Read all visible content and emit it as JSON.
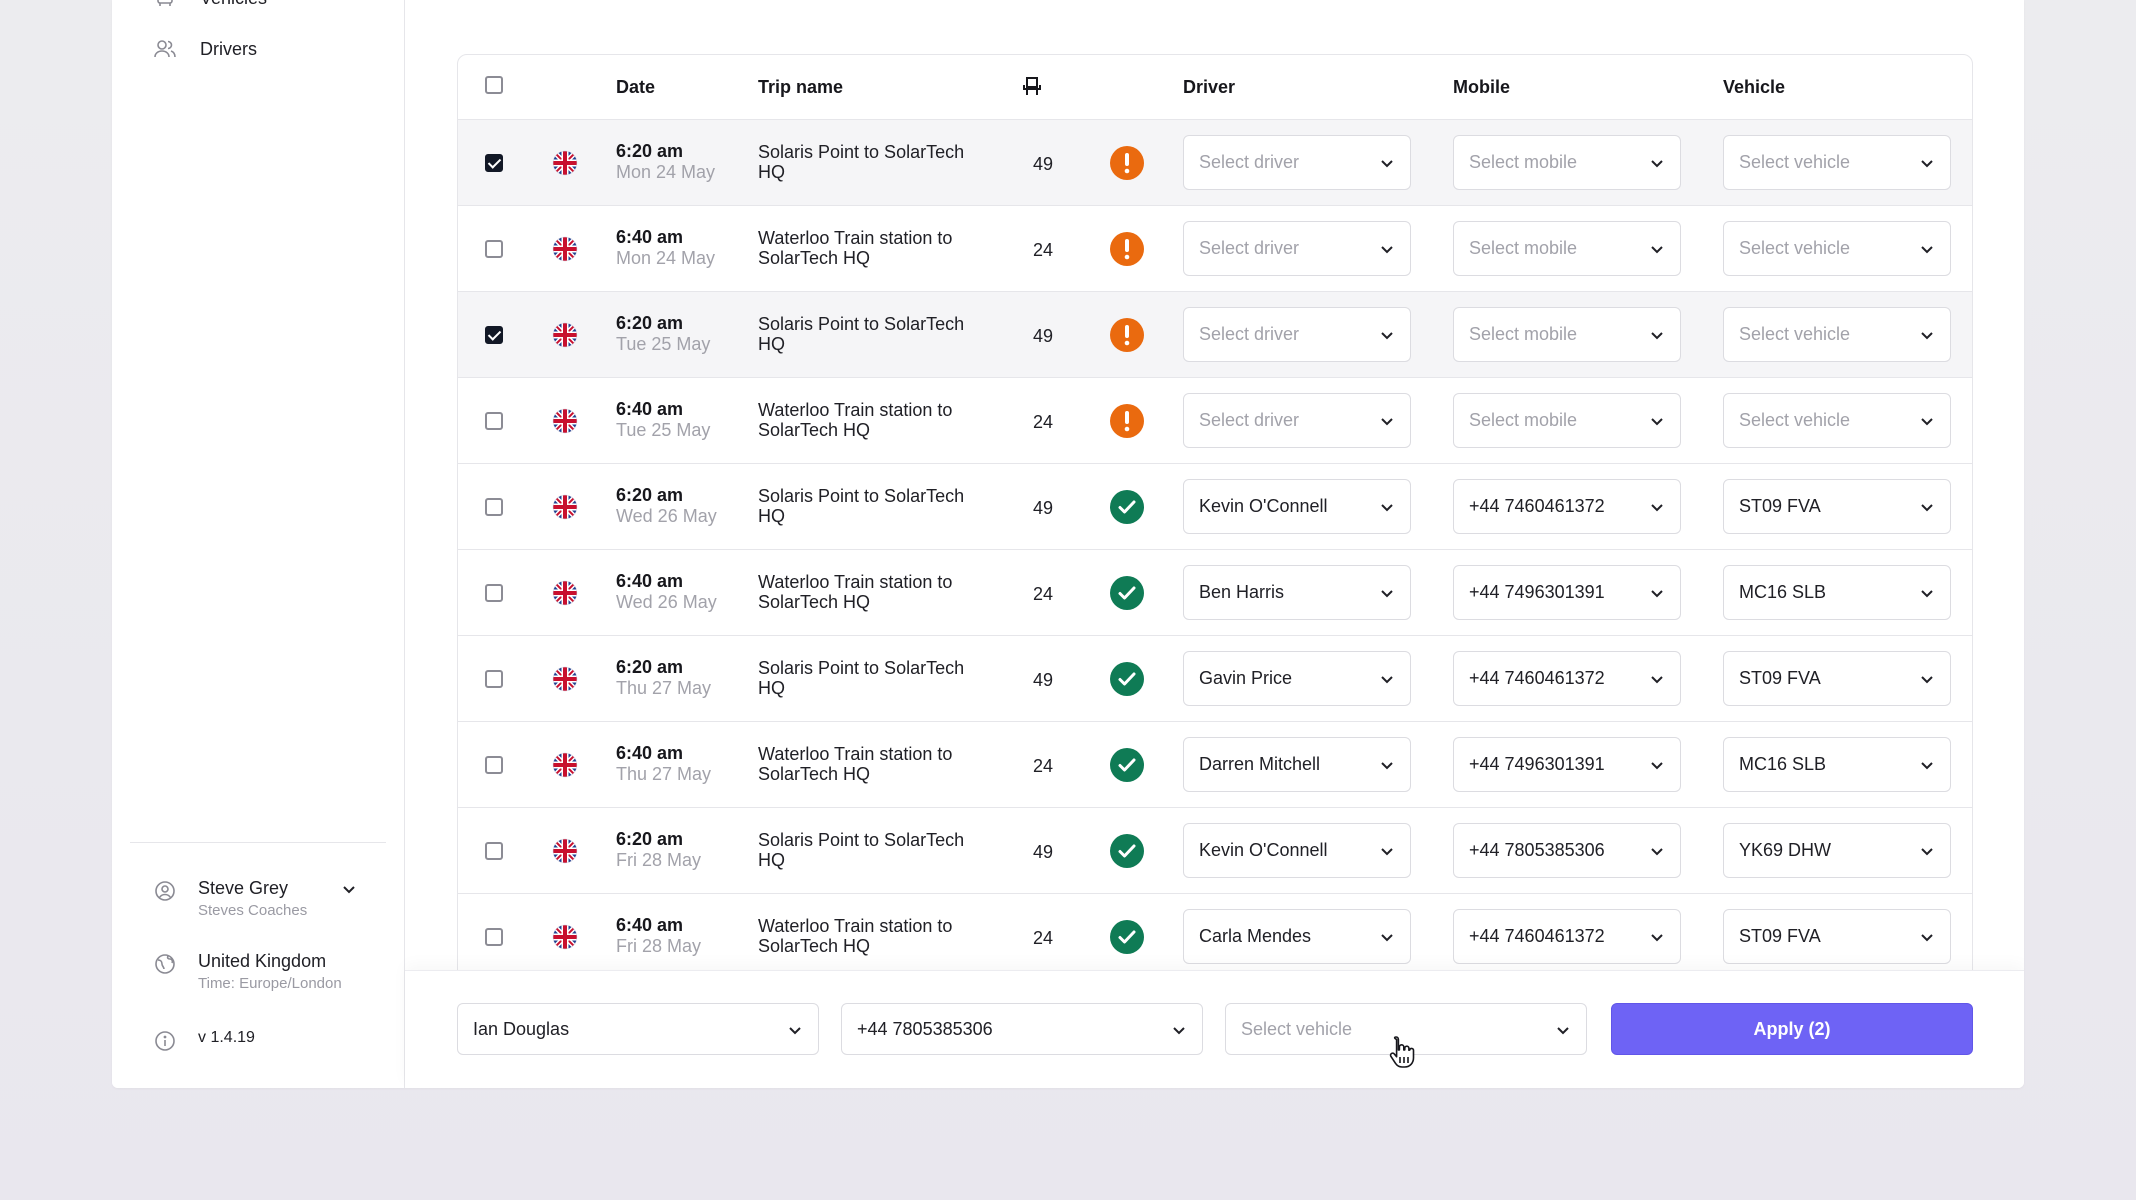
{
  "sidebar": {
    "nav": [
      {
        "label": "Vehicles",
        "icon": "vehicle-icon"
      },
      {
        "label": "Drivers",
        "icon": "users-icon"
      }
    ],
    "user": {
      "name": "Steve Grey",
      "company": "Steves Coaches",
      "icon": "user-circle-icon"
    },
    "region": {
      "country": "United Kingdom",
      "timezone": "Time: Europe/London",
      "icon": "globe-icon"
    },
    "version": {
      "label": "v 1.4.19",
      "icon": "info-icon"
    }
  },
  "table": {
    "headers": {
      "date": "Date",
      "trip": "Trip name",
      "seats_icon": "seat-icon",
      "driver": "Driver",
      "mobile": "Mobile",
      "vehicle": "Vehicle"
    },
    "placeholders": {
      "driver": "Select driver",
      "mobile": "Select mobile",
      "vehicle": "Select vehicle"
    },
    "rows": [
      {
        "selected": true,
        "time": "6:20 am",
        "date": "Mon 24 May",
        "trip": "Solaris Point to SolarTech HQ",
        "seats": "49",
        "status": "warning",
        "driver": "",
        "mobile": "",
        "vehicle": ""
      },
      {
        "selected": false,
        "time": "6:40 am",
        "date": "Mon 24 May",
        "trip": "Waterloo Train station to SolarTech HQ",
        "seats": "24",
        "status": "warning",
        "driver": "",
        "mobile": "",
        "vehicle": ""
      },
      {
        "selected": true,
        "time": "6:20 am",
        "date": "Tue 25 May",
        "trip": "Solaris Point to SolarTech HQ",
        "seats": "49",
        "status": "warning",
        "driver": "",
        "mobile": "",
        "vehicle": ""
      },
      {
        "selected": false,
        "time": "6:40 am",
        "date": "Tue 25 May",
        "trip": "Waterloo Train station to SolarTech HQ",
        "seats": "24",
        "status": "warning",
        "driver": "",
        "mobile": "",
        "vehicle": ""
      },
      {
        "selected": false,
        "time": "6:20 am",
        "date": "Wed 26 May",
        "trip": "Solaris Point to SolarTech HQ",
        "seats": "49",
        "status": "ok",
        "driver": "Kevin O'Connell",
        "mobile": "+44 7460461372",
        "vehicle": "ST09 FVA"
      },
      {
        "selected": false,
        "time": "6:40 am",
        "date": "Wed 26 May",
        "trip": "Waterloo Train station to SolarTech HQ",
        "seats": "24",
        "status": "ok",
        "driver": "Ben Harris",
        "mobile": "+44 7496301391",
        "vehicle": "MC16 SLB"
      },
      {
        "selected": false,
        "time": "6:20 am",
        "date": "Thu 27 May",
        "trip": "Solaris Point to SolarTech HQ",
        "seats": "49",
        "status": "ok",
        "driver": "Gavin Price",
        "mobile": "+44 7460461372",
        "vehicle": "ST09 FVA"
      },
      {
        "selected": false,
        "time": "6:40 am",
        "date": "Thu 27 May",
        "trip": "Waterloo Train station to SolarTech HQ",
        "seats": "24",
        "status": "ok",
        "driver": "Darren Mitchell",
        "mobile": "+44 7496301391",
        "vehicle": "MC16 SLB"
      },
      {
        "selected": false,
        "time": "6:20 am",
        "date": "Fri 28 May",
        "trip": "Solaris Point to SolarTech HQ",
        "seats": "49",
        "status": "ok",
        "driver": "Kevin O'Connell",
        "mobile": "+44 7805385306",
        "vehicle": "YK69 DHW"
      },
      {
        "selected": false,
        "time": "6:40 am",
        "date": "Fri 28 May",
        "trip": "Waterloo Train station to SolarTech HQ",
        "seats": "24",
        "status": "ok",
        "driver": "Carla Mendes",
        "mobile": "+44 7460461372",
        "vehicle": "ST09 FVA"
      }
    ]
  },
  "bulk": {
    "driver": "Ian Douglas",
    "mobile": "+44 7805385306",
    "vehicle_placeholder": "Select vehicle",
    "apply_label": "Apply (2)"
  },
  "colors": {
    "accent": "#6e63f5",
    "warning": "#ea6a0f",
    "ok": "#0f7b55",
    "checkbox": "#121826"
  }
}
